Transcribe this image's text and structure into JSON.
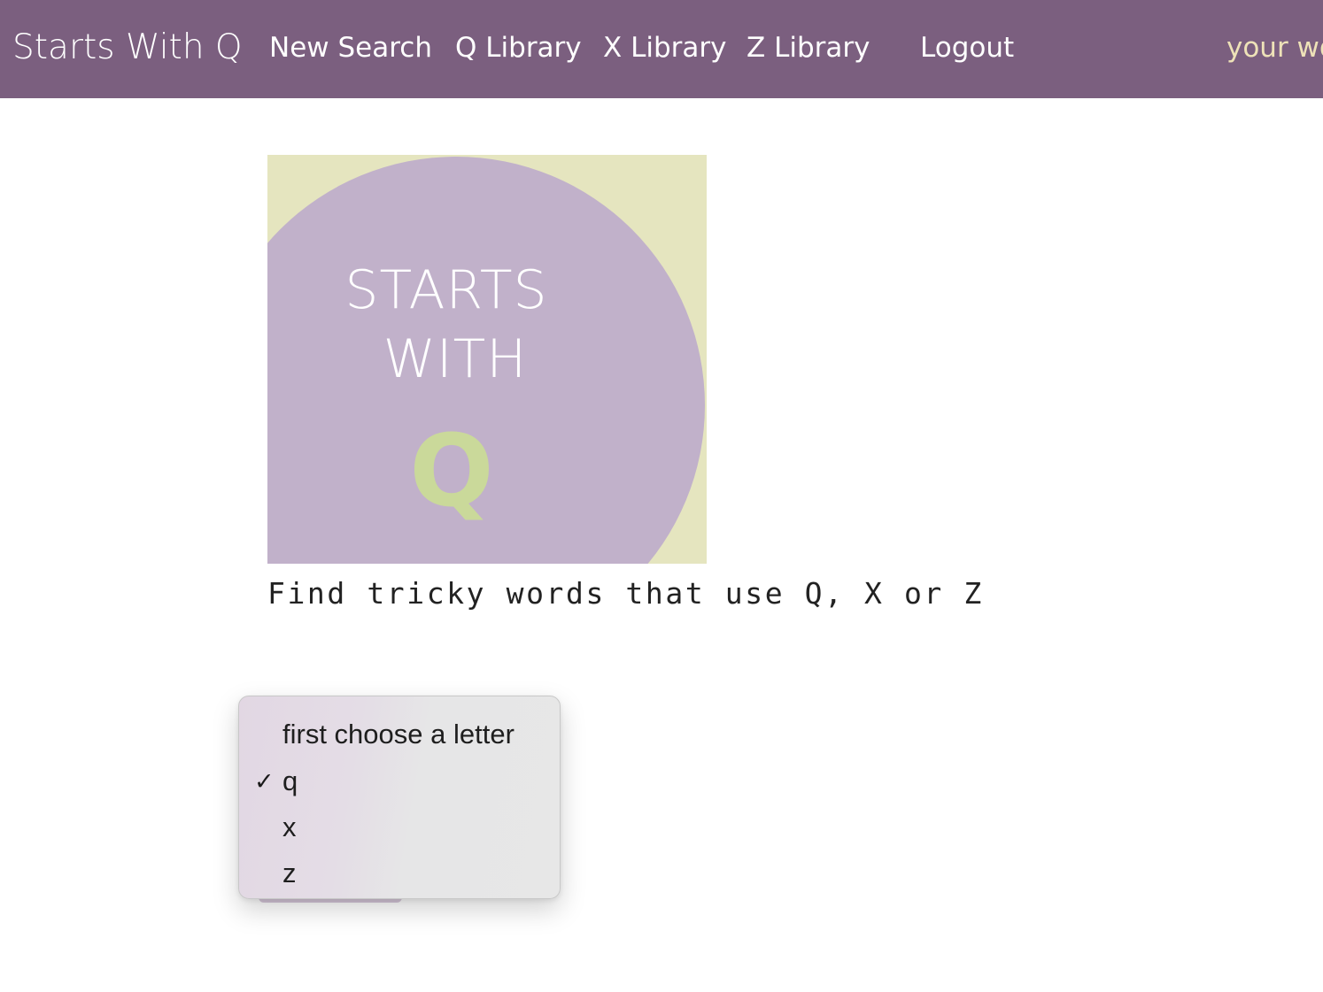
{
  "navbar": {
    "brand": "Starts With Q",
    "links": {
      "new_search": "New Search",
      "q_library": "Q Library",
      "x_library": "X Library",
      "z_library": "Z Library",
      "logout": "Logout"
    },
    "user_text": "your wo",
    "background_color": "#7b5f7f",
    "user_text_color": "#eee2b8"
  },
  "logo": {
    "line1": "STARTS",
    "line2": "WITH",
    "letter": "Q",
    "colors": {
      "background": "#e5e5bf",
      "circle": "#c1b1ca",
      "letter": "#cad99a"
    }
  },
  "tagline": "Find tricky words that use Q, X or Z",
  "letter_select": {
    "selected": "q",
    "options": [
      {
        "label": "first choose a letter",
        "checked": false
      },
      {
        "label": "q",
        "checked": true
      },
      {
        "label": "x",
        "checked": false
      },
      {
        "label": "z",
        "checked": false
      }
    ],
    "check_glyph": "✓"
  }
}
